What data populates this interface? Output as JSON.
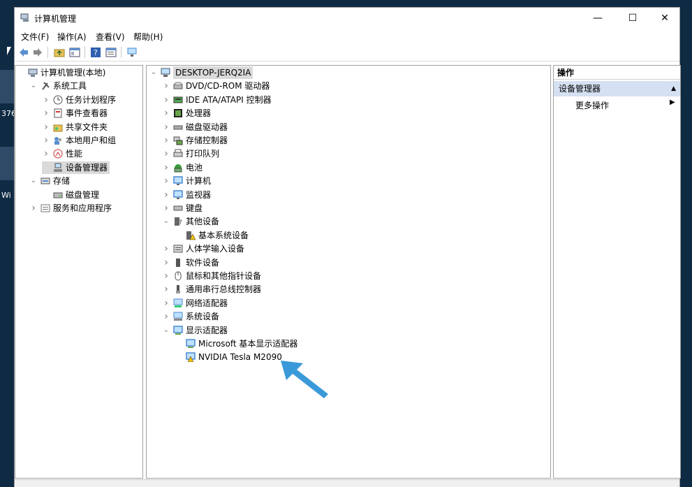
{
  "desktop": {
    "text_1": "376",
    "text_2": "Wi"
  },
  "window": {
    "title": "计算机管理",
    "controls": {
      "minimize": "—",
      "maximize": "☐",
      "close": "✕"
    }
  },
  "menubar": [
    "文件(F)",
    "操作(A)",
    "查看(V)",
    "帮助(H)"
  ],
  "left_tree": [
    {
      "label": "计算机管理(本地)",
      "level": 0,
      "expander": "",
      "icon": "computer-management-icon"
    },
    {
      "label": "系统工具",
      "level": 1,
      "expander": "down",
      "icon": "tools-icon"
    },
    {
      "label": "任务计划程序",
      "level": 2,
      "expander": "right",
      "icon": "clock-icon"
    },
    {
      "label": "事件查看器",
      "level": 2,
      "expander": "right",
      "icon": "event-viewer-icon"
    },
    {
      "label": "共享文件夹",
      "level": 2,
      "expander": "right",
      "icon": "shared-folder-icon"
    },
    {
      "label": "本地用户和组",
      "level": 2,
      "expander": "right",
      "icon": "users-icon"
    },
    {
      "label": "性能",
      "level": 2,
      "expander": "right",
      "icon": "performance-icon"
    },
    {
      "label": "设备管理器",
      "level": 2,
      "expander": "",
      "icon": "device-manager-icon",
      "selected": true
    },
    {
      "label": "存储",
      "level": 1,
      "expander": "down",
      "icon": "storage-icon"
    },
    {
      "label": "磁盘管理",
      "level": 2,
      "expander": "",
      "icon": "disk-management-icon"
    },
    {
      "label": "服务和应用程序",
      "level": 1,
      "expander": "right",
      "icon": "services-icon"
    }
  ],
  "device_tree": [
    {
      "label": "DESKTOP-JERQ2IA",
      "level": 0,
      "expander": "down",
      "icon": "computer-icon",
      "root": true
    },
    {
      "label": "DVD/CD-ROM 驱动器",
      "level": 1,
      "expander": "right",
      "icon": "dvd-icon"
    },
    {
      "label": "IDE ATA/ATAPI 控制器",
      "level": 1,
      "expander": "right",
      "icon": "ide-controller-icon"
    },
    {
      "label": "处理器",
      "level": 1,
      "expander": "right",
      "icon": "processor-icon"
    },
    {
      "label": "磁盘驱动器",
      "level": 1,
      "expander": "right",
      "icon": "disk-drive-icon"
    },
    {
      "label": "存储控制器",
      "level": 1,
      "expander": "right",
      "icon": "storage-controller-icon"
    },
    {
      "label": "打印队列",
      "level": 1,
      "expander": "right",
      "icon": "printer-icon"
    },
    {
      "label": "电池",
      "level": 1,
      "expander": "right",
      "icon": "battery-icon"
    },
    {
      "label": "计算机",
      "level": 1,
      "expander": "right",
      "icon": "monitor-icon"
    },
    {
      "label": "监视器",
      "level": 1,
      "expander": "right",
      "icon": "monitor-icon"
    },
    {
      "label": "键盘",
      "level": 1,
      "expander": "right",
      "icon": "keyboard-icon"
    },
    {
      "label": "其他设备",
      "level": 1,
      "expander": "down",
      "icon": "other-devices-icon"
    },
    {
      "label": "基本系统设备",
      "level": 2,
      "expander": "",
      "icon": "warning-device-icon"
    },
    {
      "label": "人体学输入设备",
      "level": 1,
      "expander": "right",
      "icon": "hid-icon"
    },
    {
      "label": "软件设备",
      "level": 1,
      "expander": "right",
      "icon": "software-device-icon"
    },
    {
      "label": "鼠标和其他指针设备",
      "level": 1,
      "expander": "right",
      "icon": "mouse-icon"
    },
    {
      "label": "通用串行总线控制器",
      "level": 1,
      "expander": "right",
      "icon": "usb-icon"
    },
    {
      "label": "网络适配器",
      "level": 1,
      "expander": "right",
      "icon": "network-adapter-icon"
    },
    {
      "label": "系统设备",
      "level": 1,
      "expander": "right",
      "icon": "system-devices-icon"
    },
    {
      "label": "显示适配器",
      "level": 1,
      "expander": "down",
      "icon": "display-adapter-icon"
    },
    {
      "label": "Microsoft 基本显示适配器",
      "level": 2,
      "expander": "",
      "icon": "display-adapter-icon"
    },
    {
      "label": "NVIDIA Tesla M2090",
      "level": 2,
      "expander": "",
      "icon": "display-adapter-warning-icon"
    }
  ],
  "actions": {
    "header": "操作",
    "section": "设备管理器",
    "more": "更多操作"
  },
  "colors": {
    "accent_arrow": "#3a9ad9",
    "section_bg": "#d5e1f2",
    "selected_bg": "#dadada"
  }
}
